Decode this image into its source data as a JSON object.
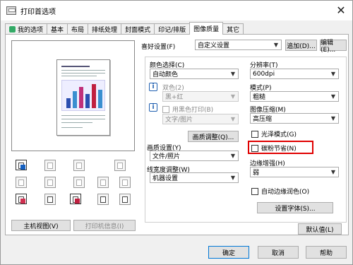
{
  "window": {
    "title": "打印首选项",
    "close_glyph": "✕"
  },
  "tabs": [
    "我的选项",
    "基本",
    "布局",
    "排纸处理",
    "封面模式",
    "印记/排版",
    "图像质量",
    "其它"
  ],
  "left": {
    "host_view": "主机视图(V)",
    "printer_info": "打印机信息(I)"
  },
  "favorites": {
    "label": "喜好设置(F)",
    "value": "自定义设置",
    "add": "追加(D)...",
    "edit": "编辑(E)..."
  },
  "col1": {
    "color_select_label": "颜色选择(C)",
    "color_select_value": "自动颜色",
    "dual_color_label": "双色(2)",
    "dual_color_value": "黑+红",
    "black_print_label": "用黑色打印(B)",
    "black_print_value": "文字/图片",
    "quality_adjust": "画质调整(Q)...",
    "quality_label": "画质设置(Y)",
    "quality_value": "文件/照片",
    "line_width_label": "线宽度调整(W)",
    "line_width_value": "机器设置"
  },
  "col2": {
    "resolution_label": "分辨率(T)",
    "resolution_value": "600dpi",
    "pattern_label": "模式(P)",
    "pattern_value": "粗糙",
    "compression_label": "图像压缩(M)",
    "compression_value": "高压缩",
    "gloss_label": "光泽模式(G)",
    "toner_save_label": "碳粉节省(N)",
    "edge_label": "边缘增强(H)",
    "edge_value": "弱",
    "auto_trap_label": "自动边缘润色(O)",
    "font_settings": "设置字体(S)..."
  },
  "defaults": "默认值(L)",
  "footer": {
    "ok": "确定",
    "cancel": "取消",
    "help": "帮助"
  },
  "colors": {
    "highlight": "#e00000",
    "info": "#1f5fb0"
  }
}
